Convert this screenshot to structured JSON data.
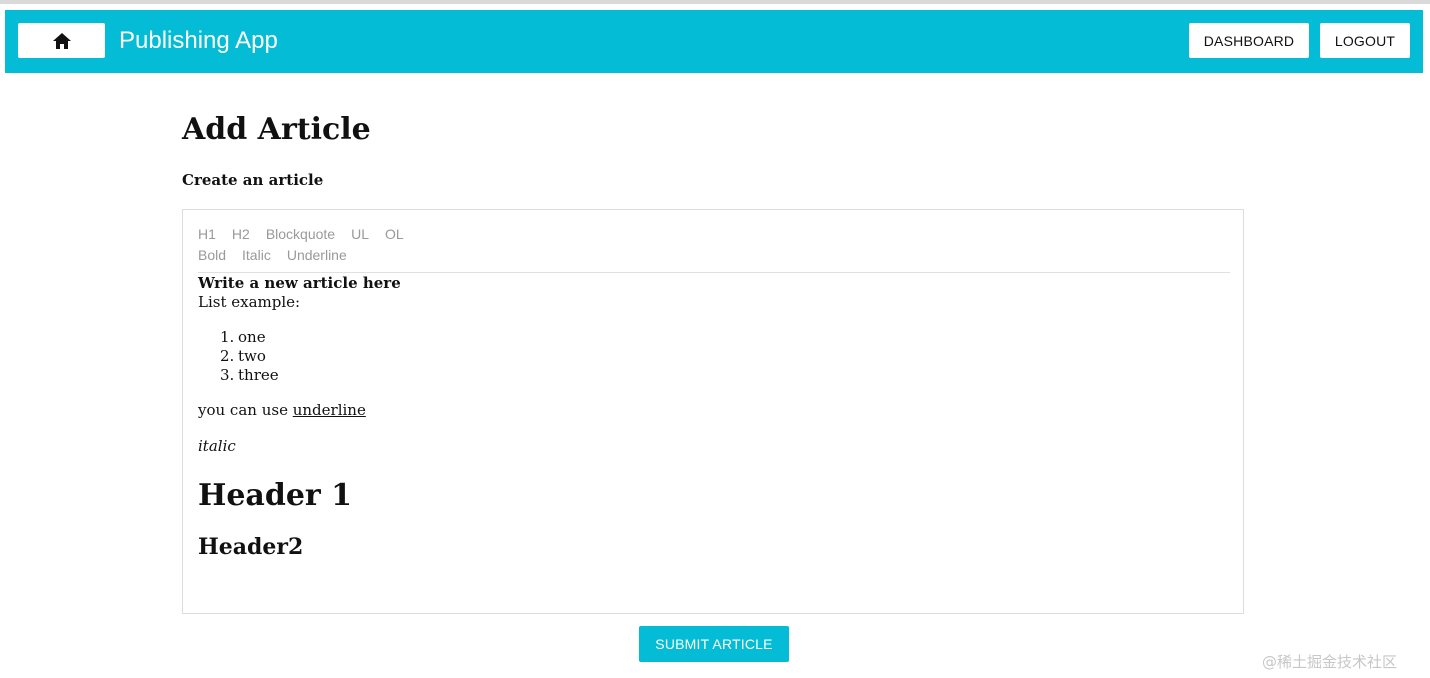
{
  "appbar": {
    "title": "Publishing App",
    "home_icon": "home-icon",
    "dashboard_label": "DASHBOARD",
    "logout_label": "LOGOUT",
    "color": "#04bcd6"
  },
  "page": {
    "title": "Add Article",
    "subtitle": "Create an article"
  },
  "editor": {
    "toolbar_row1": [
      "H1",
      "H2",
      "Blockquote",
      "UL",
      "OL"
    ],
    "toolbar_row2": [
      "Bold",
      "Italic",
      "Underline"
    ],
    "content": {
      "heading": "Write a new article here",
      "list_intro": "List example:",
      "list_items": [
        {
          "num": "1.",
          "text": "one"
        },
        {
          "num": "2.",
          "text": "two"
        },
        {
          "num": "3.",
          "text": "three"
        }
      ],
      "underline_prefix": "you can use ",
      "underline_word": "underline",
      "italic_text": "italic",
      "header1": "Header 1",
      "header2": "Header2"
    }
  },
  "submit_label": "SUBMIT ARTICLE",
  "watermark": "@稀土掘金技术社区"
}
